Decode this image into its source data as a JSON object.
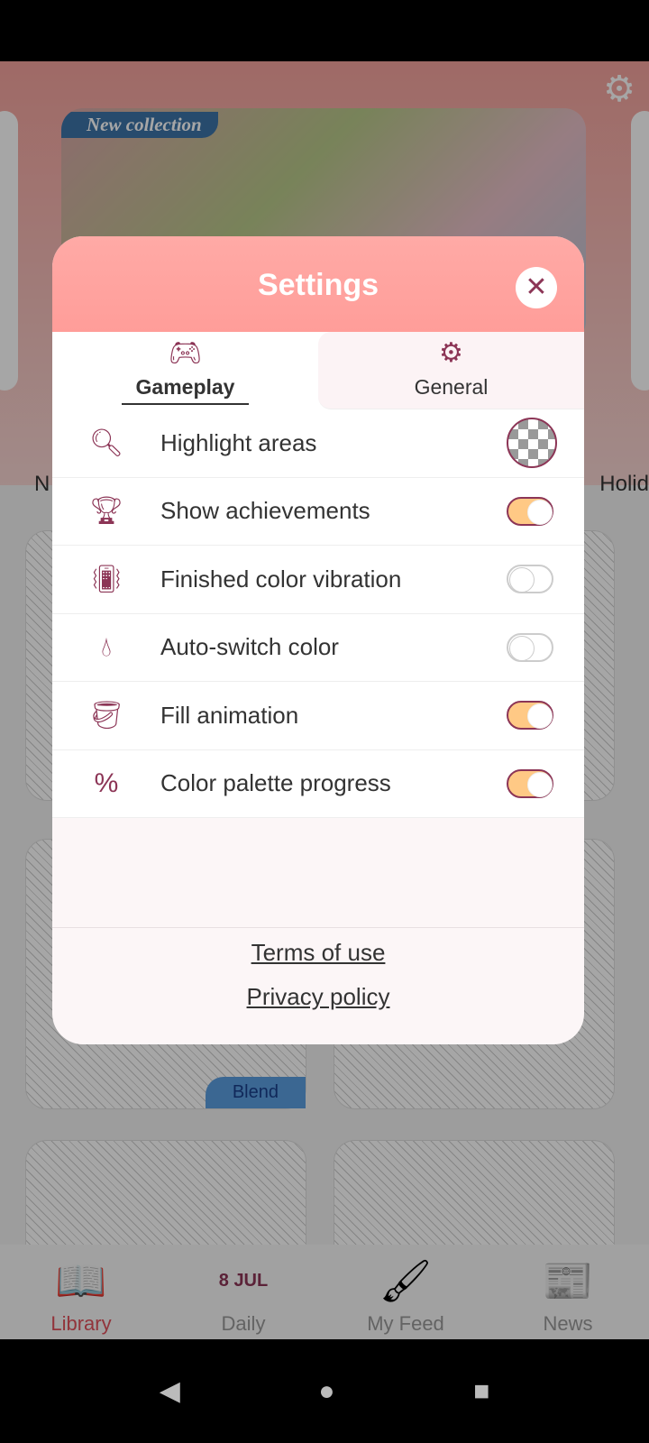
{
  "background": {
    "banner_tag": "New collection",
    "section_left": "N",
    "section_right": "Holid",
    "card_badge": "Blend",
    "nav": [
      {
        "label": "Library",
        "icon": "book-icon",
        "active": true
      },
      {
        "label": "Daily",
        "icon": "calendar-icon",
        "day": "8",
        "month": "JUL"
      },
      {
        "label": "My Feed",
        "icon": "brushes-icon"
      },
      {
        "label": "News",
        "icon": "newspaper-icon"
      }
    ]
  },
  "modal": {
    "title": "Settings",
    "tabs": [
      {
        "label": "Gameplay",
        "icon": "gamepad-icon",
        "active": true
      },
      {
        "label": "General",
        "icon": "gear-icon",
        "active": false
      }
    ],
    "rows": [
      {
        "label": "Highlight areas",
        "icon": "magnifier-icon",
        "control": "checker"
      },
      {
        "label": "Show achievements",
        "icon": "trophy-icon",
        "on": true
      },
      {
        "label": "Finished color vibration",
        "icon": "phone-vibrate-icon",
        "on": false
      },
      {
        "label": "Auto-switch color",
        "icon": "drop-switch-icon",
        "on": false
      },
      {
        "label": "Fill animation",
        "icon": "paint-bucket-icon",
        "on": true
      },
      {
        "label": "Color palette progress",
        "icon": "percent-progress-icon",
        "on": true
      }
    ],
    "links": {
      "terms": "Terms of use",
      "privacy": "Privacy policy"
    }
  },
  "colors": {
    "accent": "#ff9d99",
    "toggle_on": "#ffc985",
    "icon": "#8c3556"
  }
}
